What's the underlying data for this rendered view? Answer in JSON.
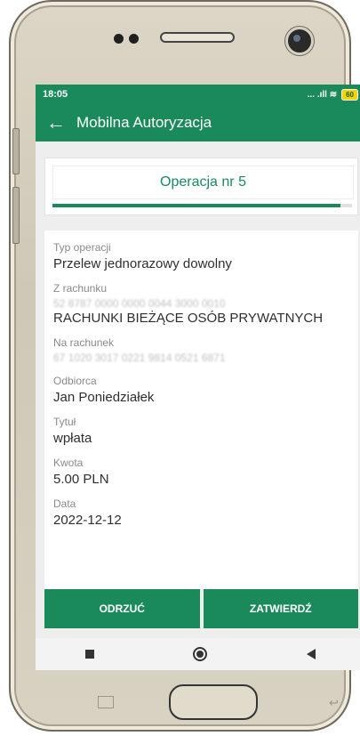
{
  "status_bar": {
    "time": "18:05",
    "icons": "... .ıll ≋",
    "battery": "60"
  },
  "app_bar": {
    "back_icon": "←",
    "title": "Mobilna Autoryzacja"
  },
  "operation": {
    "title": "Operacja nr 5",
    "progress": 0.96
  },
  "details": {
    "type_label": "Typ operacji",
    "type_value": "Przelew jednorazowy dowolny",
    "from_label": "Z rachunku",
    "from_number": "52 8787 0000 0000 0044 3000 0010",
    "from_name": "RACHUNKI BIEŻĄCE OSÓB PRYWATNYCH",
    "to_label": "Na rachunek",
    "to_number": "67 1020 3017 0221 9814 0521 6871",
    "recipient_label": "Odbiorca",
    "recipient_value": "Jan Poniedziałek",
    "title_label": "Tytuł",
    "title_value": "wpłata",
    "amount_label": "Kwota",
    "amount_value": "5.00 PLN",
    "date_label": "Data",
    "date_value": "2022-12-12"
  },
  "buttons": {
    "reject": "ODRZUĆ",
    "confirm": "ZATWIERDŹ"
  },
  "colors": {
    "primary": "#1a8a5b"
  }
}
